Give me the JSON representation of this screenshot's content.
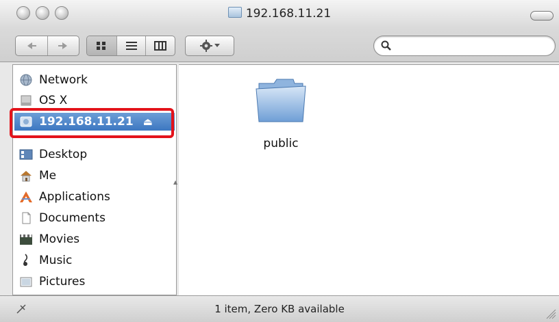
{
  "window": {
    "title": "192.168.11.21",
    "status": "1 item, Zero KB available"
  },
  "toolbar": {
    "back_icon": "back-arrow-icon",
    "forward_icon": "forward-arrow-icon",
    "view_icons": "icon-view-icon",
    "view_list": "list-view-icon",
    "view_columns": "column-view-icon",
    "action_icon": "gear-icon",
    "search_placeholder": ""
  },
  "sidebar": {
    "items": [
      {
        "label": "Network",
        "icon": "network-globe-icon"
      },
      {
        "label": "OS X",
        "icon": "hard-drive-icon"
      },
      {
        "label": "192.168.11.21",
        "icon": "server-icon"
      },
      {
        "label": "Desktop",
        "icon": "desktop-icon"
      },
      {
        "label": "Me",
        "icon": "home-icon"
      },
      {
        "label": "Applications",
        "icon": "applications-icon"
      },
      {
        "label": "Documents",
        "icon": "documents-icon"
      },
      {
        "label": "Movies",
        "icon": "movies-icon"
      },
      {
        "label": "Music",
        "icon": "music-icon"
      },
      {
        "label": "Pictures",
        "icon": "pictures-icon"
      }
    ],
    "selected_eject": "⏏"
  },
  "content": {
    "items": [
      {
        "label": "public",
        "icon": "folder-icon"
      }
    ]
  },
  "colors": {
    "selection": "#3c77c1",
    "highlight_annotation": "#e3131b"
  }
}
